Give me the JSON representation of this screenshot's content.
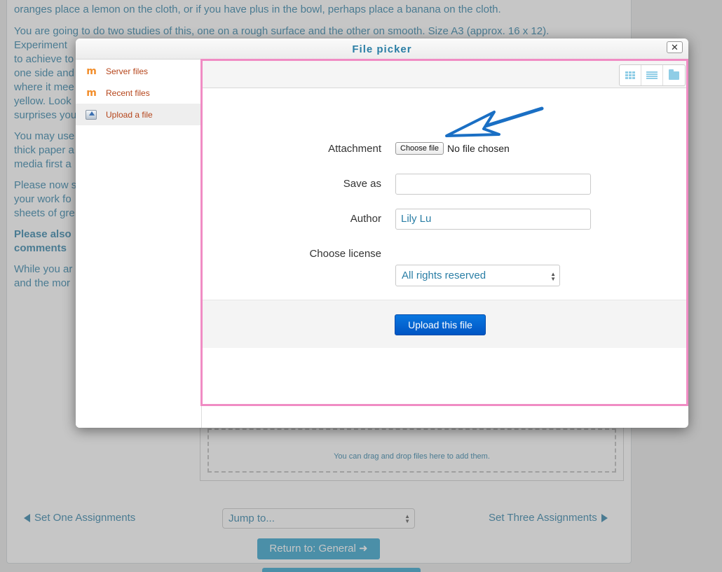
{
  "background": {
    "paragraphs": [
      "oranges place a lemon on the cloth, or if you have plus in the bowl, perhaps place a banana on the cloth.",
      "You are going to do two studies of this, one on a rough surface and the other on smooth. Size A3 (approx. 16 x 12).",
      "Experiment",
      "to achieve to",
      "one side and",
      "where it mee",
      "yellow. Look",
      "surprises you",
      "You may use",
      "thick paper a",
      "media first a",
      "Please now s",
      "your work fo",
      "sheets of gre",
      "Please also",
      "comments",
      "While you ar",
      "and the mor"
    ],
    "dropzone_text": "You can drag and drop files here to add them.",
    "prev_link": "Set One Assignments",
    "next_link": "Set Three Assignments",
    "jump_select": "Jump to...",
    "return_button": "Return to: General"
  },
  "dialog": {
    "title": "File picker",
    "close_label": "✕",
    "sidebar": [
      {
        "label": "Server files",
        "icon": "moodle-icon"
      },
      {
        "label": "Recent files",
        "icon": "moodle-icon"
      },
      {
        "label": "Upload a file",
        "icon": "upload-icon",
        "active": true
      }
    ],
    "toolbar": {
      "views": [
        "grid-view-icon",
        "list-view-icon",
        "folder-view-icon"
      ]
    },
    "form": {
      "attachment_label": "Attachment",
      "choose_file_button": "Choose file",
      "no_file_text": "No file chosen",
      "save_as_label": "Save as",
      "save_as_value": "",
      "author_label": "Author",
      "author_value": "Lily Lu",
      "license_label": "Choose license",
      "license_value": "All rights reserved",
      "upload_button": "Upload this file"
    }
  },
  "colors": {
    "accent": "#2a7ea5",
    "sidebar_link": "#b5451b",
    "focus_frame": "#f08cc4",
    "arrow": "#1a6fc4"
  }
}
